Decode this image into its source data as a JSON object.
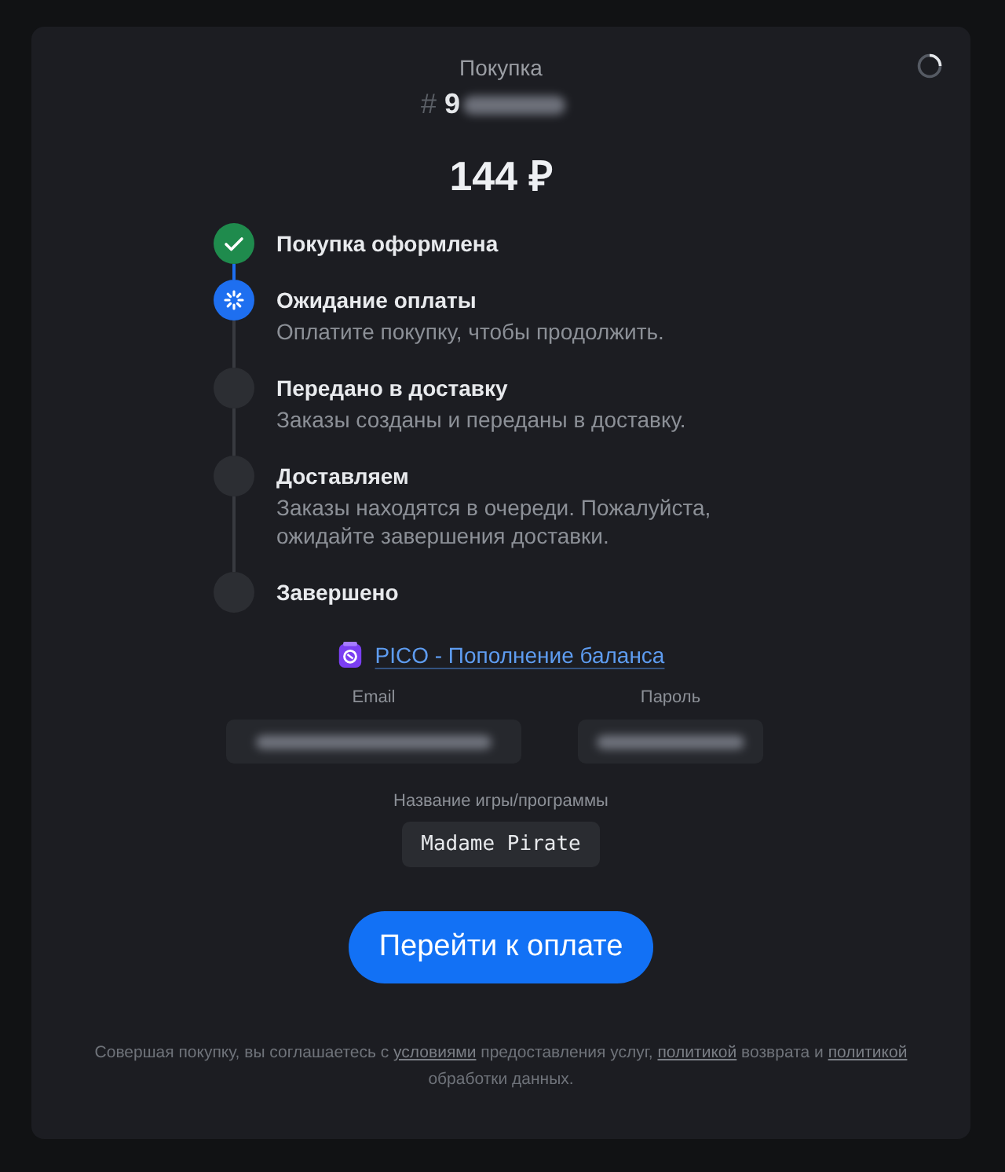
{
  "header": {
    "title": "Покупка",
    "order_prefix": "#",
    "order_number_visible": "9",
    "order_number_blurred": true,
    "loading": true
  },
  "price": "144 ₽",
  "steps": [
    {
      "title": "Покупка оформлена",
      "kind": "done"
    },
    {
      "title": "Ожидание оплаты",
      "description": "Оплатите покупку, чтобы продолжить.",
      "kind": "active"
    },
    {
      "title": "Передано в доставку",
      "description": "Заказы созданы и переданы в доставку.",
      "kind": "pending"
    },
    {
      "title": "Доставляем",
      "description": "Заказы находятся в очереди. Пожалуйста, ожидайте завершения доставки.",
      "kind": "pending"
    },
    {
      "title": "Завершено",
      "kind": "pending"
    }
  ],
  "product": {
    "name": "PICO - Пополнение баланса"
  },
  "fields": [
    {
      "label": "Email",
      "blurred": true
    },
    {
      "label": "Пароль",
      "blurred": true
    }
  ],
  "game_field": {
    "label": "Название игры/программы",
    "value": "Madame Pirate"
  },
  "pay_button": "Перейти к оплате",
  "footer": [
    {
      "text": "Совершая покупку, вы соглашаетесь с ",
      "link": false
    },
    {
      "text": "условиями",
      "link": true
    },
    {
      "text": " предоставления услуг, ",
      "link": false
    },
    {
      "text": "политикой",
      "link": true
    },
    {
      "text": " возврата и ",
      "link": false
    },
    {
      "text": "политикой",
      "link": true
    },
    {
      "text": " обработки данных.",
      "link": false
    }
  ]
}
